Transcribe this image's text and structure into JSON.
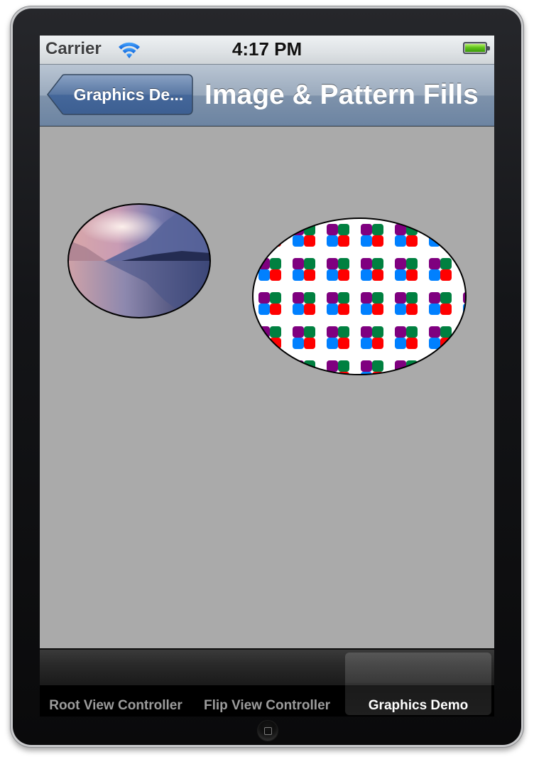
{
  "status_bar": {
    "carrier": "Carrier",
    "time": "4:17 PM",
    "wifi_icon": "wifi-icon",
    "battery_icon": "battery-full-icon"
  },
  "nav_bar": {
    "back_label": "Graphics De...",
    "title": "Image & Pattern Fills"
  },
  "content": {
    "background_color": "#aaaaaa",
    "image_fill": {
      "shape": "ellipse",
      "description": "misty mountain lake reflection at dawn"
    },
    "pattern_fill": {
      "shape": "ellipse",
      "tile_colors": {
        "top_left": "#7f007f",
        "top_right": "#008040",
        "bottom_left": "#0080ff",
        "bottom_right": "#ff0000"
      }
    }
  },
  "tab_bar": {
    "tabs": [
      {
        "label": "Root View Controller",
        "selected": false
      },
      {
        "label": "Flip View Controller",
        "selected": false
      },
      {
        "label": "Graphics Demo",
        "selected": true
      }
    ]
  }
}
